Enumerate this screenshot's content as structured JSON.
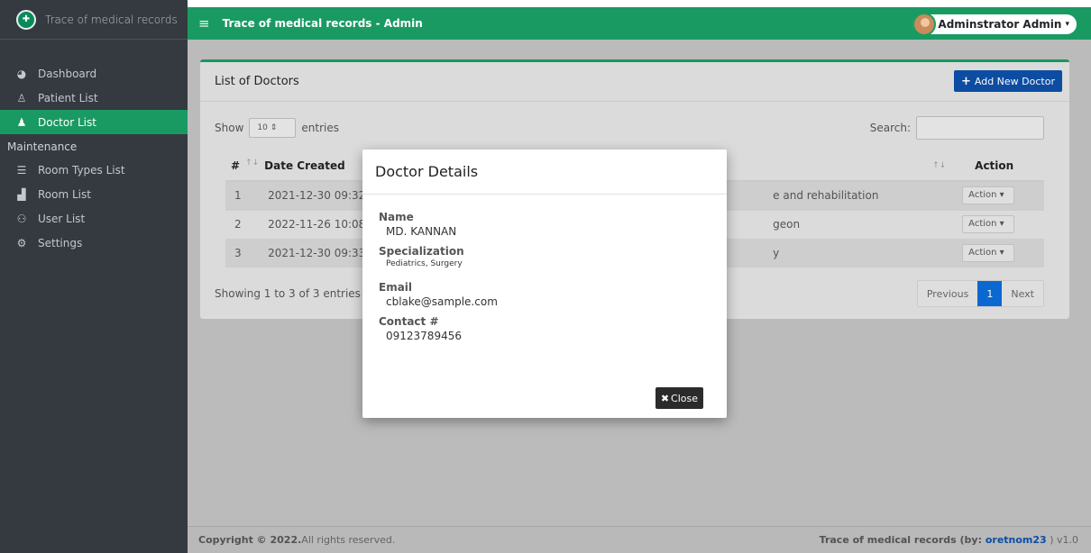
{
  "brand": {
    "name": "Trace of medical records"
  },
  "sidebar": {
    "items": [
      {
        "label": "Dashboard",
        "icon": "tachometer-icon",
        "glyph": "◕"
      },
      {
        "label": "Patient List",
        "icon": "user-injured-icon",
        "glyph": "♙"
      },
      {
        "label": "Doctor List",
        "icon": "user-md-icon",
        "glyph": "♟",
        "active": true
      }
    ],
    "maintenance_header": "Maintenance",
    "maintenance_items": [
      {
        "label": "Room Types List",
        "icon": "th-list-icon",
        "glyph": "☰"
      },
      {
        "label": "Room List",
        "icon": "door-icon",
        "glyph": "▟"
      },
      {
        "label": "User List",
        "icon": "users-icon",
        "glyph": "⚇"
      },
      {
        "label": "Settings",
        "icon": "cogs-icon",
        "glyph": "⚙"
      }
    ]
  },
  "topbar": {
    "hamburger": "≡",
    "title": "Trace of medical records - Admin",
    "user": "Adminstrator Admin",
    "caret": "▾"
  },
  "card": {
    "title": "List of Doctors",
    "add_button": "Add New Doctor",
    "add_plus": "+"
  },
  "table_controls": {
    "show": "Show",
    "entries_value": "10 ⇕",
    "entries": "entries",
    "search_label": "Search:"
  },
  "table": {
    "columns": [
      "#",
      "Date Created",
      "",
      "Action"
    ],
    "sort_glyph": "↑↓",
    "rows": [
      {
        "num": "1",
        "date": "2021-12-30 09:32",
        "spec": "e and rehabilitation",
        "action": "Action ▾"
      },
      {
        "num": "2",
        "date": "2022-11-26 10:08",
        "spec": "geon",
        "action": "Action ▾"
      },
      {
        "num": "3",
        "date": "2021-12-30 09:33",
        "spec": "y",
        "action": "Action ▾"
      }
    ]
  },
  "pagination": {
    "info": "Showing 1 to 3 of 3 entries",
    "previous": "Previous",
    "current": "1",
    "next": "Next"
  },
  "modal": {
    "title": "Doctor Details",
    "name_label": "Name",
    "name_value": "MD. KANNAN",
    "spec_label": "Specialization",
    "spec_value": "Pediatrics, Surgery",
    "email_label": "Email",
    "email_value": "cblake@sample.com",
    "contact_label": "Contact #",
    "contact_value": "09123789456",
    "close_button": "Close",
    "close_x": "✖"
  },
  "footer": {
    "copyright_bold": "Copyright © 2022.",
    "copyright_rest": " All rights reserved.",
    "right_prefix": "Trace of medical records (by: ",
    "author": "oretnom23",
    "right_suffix": " ) v1.0"
  },
  "colors": {
    "accent": "#1a9a63",
    "primary": "#0d4fa6",
    "sidebar": "#343a40"
  }
}
